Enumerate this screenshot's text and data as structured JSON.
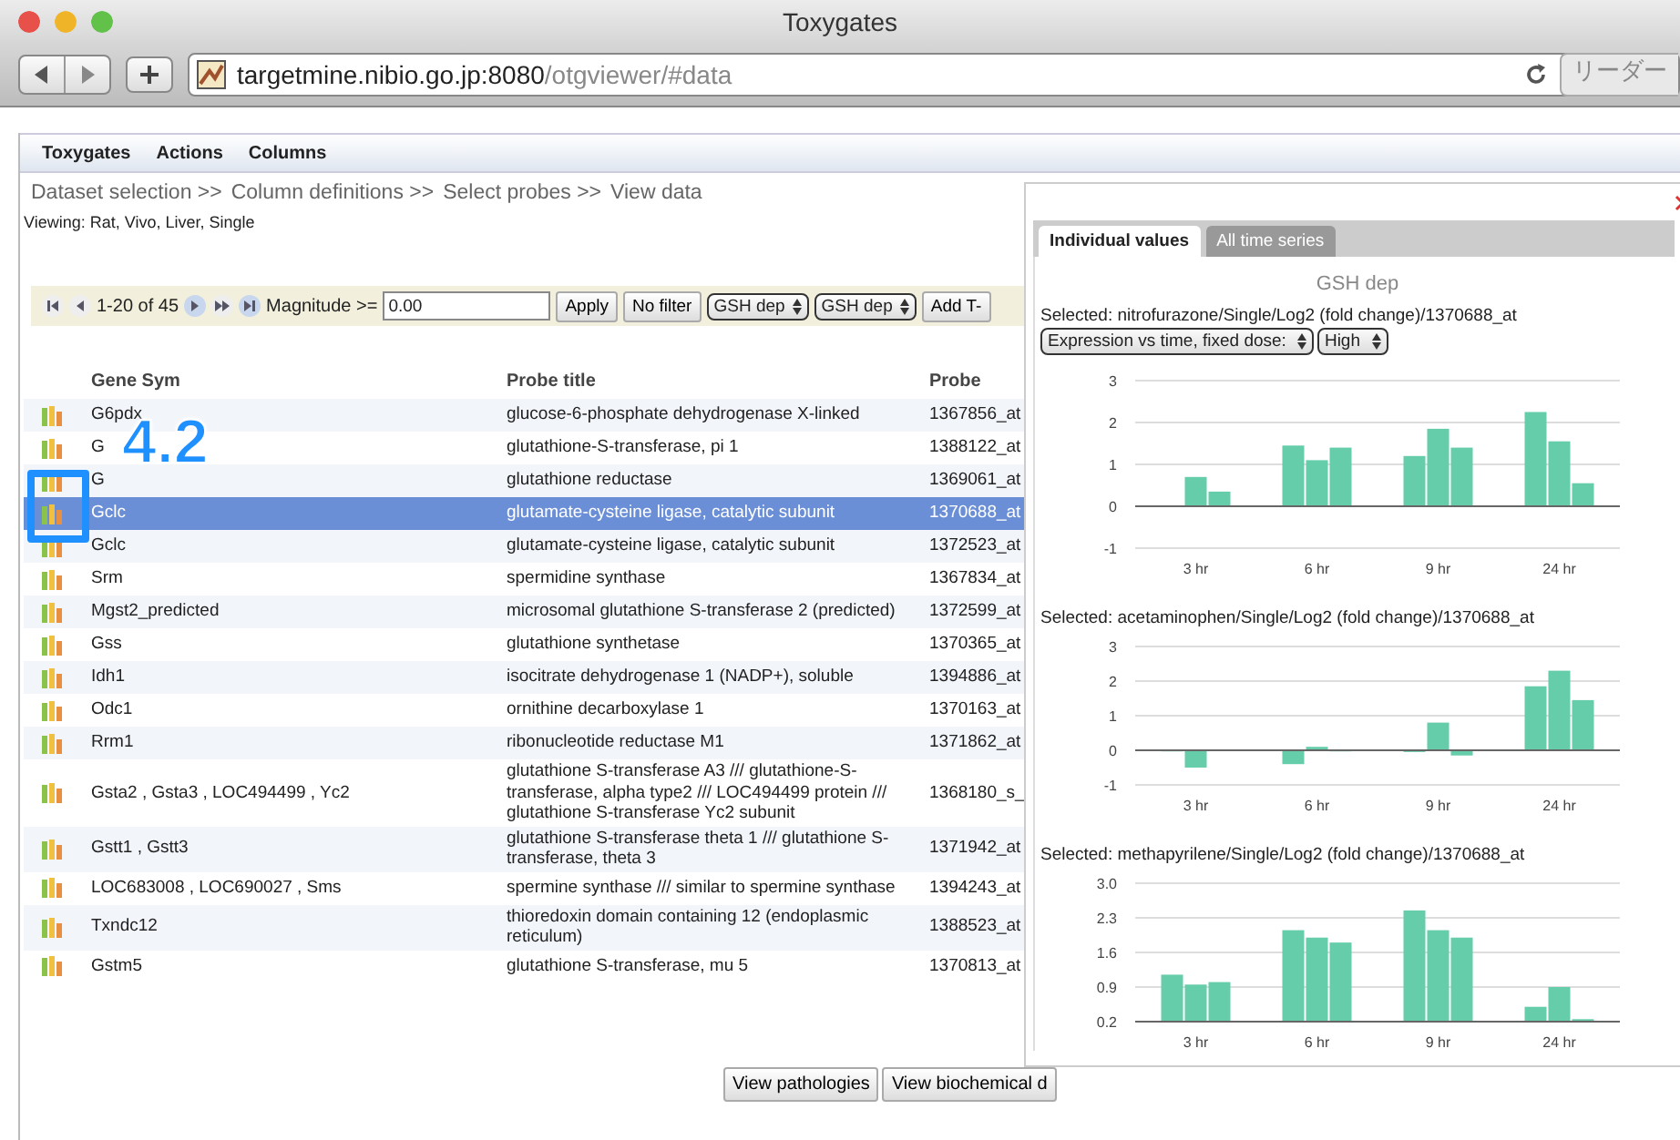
{
  "window": {
    "title": "Toxygates"
  },
  "toolbar": {
    "url_host": "targetmine.nibio.go.jp:8080",
    "url_path": "/otgviewer/#data",
    "reader_button": "リーダー"
  },
  "menu": [
    "Toxygates",
    "Actions",
    "Columns"
  ],
  "breadcrumbs": [
    "Dataset selection >>",
    "Column definitions >>",
    "Select probes >>",
    "View data"
  ],
  "viewing": "Viewing: Rat, Vivo, Liver, Single",
  "filter_bar": {
    "range": "1-20 of 45",
    "magnitude_label": "Magnitude >=",
    "magnitude_value": "0.00",
    "apply": "Apply",
    "no_filter": "No filter",
    "selects": [
      "GSH dep",
      "GSH dep"
    ],
    "add_button": "Add T-"
  },
  "table": {
    "columns": [
      "Gene Sym",
      "Probe title",
      "Probe"
    ],
    "rows": [
      {
        "gene": "G6pdx",
        "title": "glucose-6-phosphate dehydrogenase X-linked",
        "probe": "1367856_at",
        "selected": false
      },
      {
        "gene": "G",
        "title": "glutathione-S-transferase, pi 1",
        "probe": "1388122_at",
        "selected": false
      },
      {
        "gene": "G",
        "title": "glutathione reductase",
        "probe": "1369061_at",
        "selected": false
      },
      {
        "gene": "Gclc",
        "title": "glutamate-cysteine ligase, catalytic subunit",
        "probe": "1370688_at",
        "selected": true
      },
      {
        "gene": "Gclc",
        "title": "glutamate-cysteine ligase, catalytic subunit",
        "probe": "1372523_at",
        "selected": false
      },
      {
        "gene": "Srm",
        "title": "spermidine synthase",
        "probe": "1367834_at",
        "selected": false
      },
      {
        "gene": "Mgst2_predicted",
        "title": "microsomal glutathione S-transferase 2 (predicted)",
        "probe": "1372599_at",
        "selected": false
      },
      {
        "gene": "Gss",
        "title": "glutathione synthetase",
        "probe": "1370365_at",
        "selected": false
      },
      {
        "gene": "Idh1",
        "title": "isocitrate dehydrogenase 1 (NADP+), soluble",
        "probe": "1394886_at",
        "selected": false
      },
      {
        "gene": "Odc1",
        "title": "ornithine decarboxylase 1",
        "probe": "1370163_at",
        "selected": false
      },
      {
        "gene": "Rrm1",
        "title": "ribonucleotide reductase M1",
        "probe": "1371862_at",
        "selected": false
      },
      {
        "gene": "Gsta2 , Gsta3 , LOC494499 , Yc2",
        "title": "glutathione S-transferase A3 /// glutathione-S-transferase, alpha type2 /// LOC494499 protein /// glutathione S-transferase Yc2 subunit",
        "probe": "1368180_s_",
        "selected": false
      },
      {
        "gene": "Gstt1 , Gstt3",
        "title": "glutathione S-transferase theta 1 /// glutathione S-transferase, theta 3",
        "probe": "1371942_at",
        "selected": false
      },
      {
        "gene": "LOC683008 , LOC690027 , Sms",
        "title": "spermine synthase /// similar to spermine synthase",
        "probe": "1394243_at",
        "selected": false
      },
      {
        "gene": "Txndc12",
        "title": "thioredoxin domain containing 12 (endoplasmic reticulum)",
        "probe": "1388523_at",
        "selected": false
      },
      {
        "gene": "Gstm5",
        "title": "glutathione S-transferase, mu 5",
        "probe": "1370813_at",
        "selected": false
      }
    ]
  },
  "annotation": {
    "label": "4.2"
  },
  "bottom_buttons": [
    "View pathologies",
    "View biochemical d"
  ],
  "popup": {
    "tabs": [
      {
        "label": "Individual values",
        "selected": true
      },
      {
        "label": "All time series",
        "selected": false
      }
    ],
    "title": "GSH dep",
    "dropdowns": [
      "Expression vs time, fixed dose:",
      "High"
    ],
    "panels": [
      {
        "caption": "Selected: nitrofurazone/Single/Log2 (fold change)/1370688_at",
        "chart_data": {
          "type": "bar",
          "grid": true,
          "categories": [
            "3 hr",
            "6 hr",
            "9 hr",
            "24 hr"
          ],
          "ylim": [
            -1,
            3
          ],
          "yticks": [
            -1,
            0,
            1,
            2,
            3
          ],
          "series": [
            {
              "color": "#66cdaa",
              "values": [
                null,
                1.45,
                1.2,
                2.25
              ]
            },
            {
              "color": "#66cdaa",
              "values": [
                0.7,
                1.1,
                1.85,
                1.55
              ]
            },
            {
              "color": "#66cdaa",
              "values": [
                0.35,
                1.4,
                1.4,
                0.55
              ]
            }
          ]
        }
      },
      {
        "caption": "Selected: acetaminophen/Single/Log2 (fold change)/1370688_at",
        "chart_data": {
          "type": "bar",
          "grid": true,
          "categories": [
            "3 hr",
            "6 hr",
            "9 hr",
            "24 hr"
          ],
          "ylim": [
            -1,
            3
          ],
          "yticks": [
            -1,
            0,
            1,
            2,
            3
          ],
          "series": [
            {
              "color": "#66cdaa",
              "values": [
                0,
                -0.4,
                -0.05,
                1.85
              ]
            },
            {
              "color": "#66cdaa",
              "values": [
                -0.5,
                0.1,
                0.8,
                2.3
              ]
            },
            {
              "color": "#66cdaa",
              "values": [
                null,
                0,
                -0.15,
                1.45
              ]
            }
          ]
        }
      },
      {
        "caption": "Selected: methapyrilene/Single/Log2 (fold change)/1370688_at",
        "chart_data": {
          "type": "bar",
          "grid": true,
          "categories": [
            "3 hr",
            "6 hr",
            "9 hr",
            "24 hr"
          ],
          "ylim": [
            0.2,
            3.0
          ],
          "yticks": [
            {
              "value": 0.2,
              "label": "0.2"
            },
            {
              "value": 0.9,
              "label": "0.9"
            },
            {
              "value": 1.6,
              "label": "1.6"
            },
            {
              "value": 2.3,
              "label": "2.3"
            },
            {
              "value": 3.0,
              "label": "3.0"
            }
          ],
          "series": [
            {
              "color": "#66cdaa",
              "values": [
                1.15,
                2.05,
                2.45,
                0.5
              ]
            },
            {
              "color": "#66cdaa",
              "values": [
                0.95,
                1.9,
                2.05,
                0.9
              ]
            },
            {
              "color": "#66cdaa",
              "values": [
                1.0,
                1.8,
                1.9,
                0.25
              ]
            }
          ]
        }
      }
    ]
  }
}
